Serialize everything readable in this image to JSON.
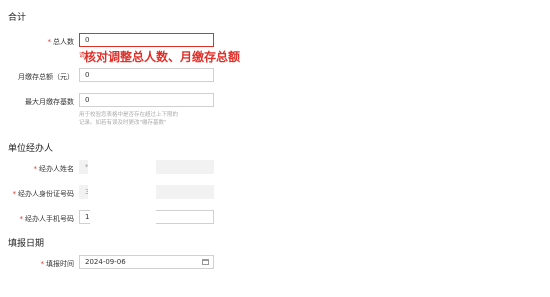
{
  "sections": {
    "total": "合计",
    "agent": "单位经办人",
    "date": "填报日期"
  },
  "fields": {
    "total_count": {
      "label": "总人数",
      "value": "0",
      "required": true,
      "error_text": "请"
    },
    "monthly_total": {
      "label": "月缴存总额（元）",
      "value": "0",
      "required": false
    },
    "max_base": {
      "label": "最大月缴存基数",
      "value": "0",
      "required": false,
      "hint_line1": "用于校验您表格中是否存在超过上下限的",
      "hint_line2": "记录。如若有误及时更改\"缴存基数\""
    },
    "agent_name": {
      "label": "经办人姓名",
      "value": "*",
      "required": true
    },
    "agent_id": {
      "label": "经办人身份证号码",
      "value": "3",
      "required": true
    },
    "agent_phone": {
      "label": "经办人手机号码",
      "value": "1:",
      "required": true
    },
    "fill_time": {
      "label": "填报时间",
      "value": "2024-09-06",
      "required": true
    }
  },
  "annotation": "核对调整总人数、月缴存总额",
  "icons": {
    "calendar": "calendar-icon"
  },
  "colors": {
    "error": "#e0302a",
    "border": "#d0d0d0",
    "disabled_bg": "#f2f2f2"
  }
}
